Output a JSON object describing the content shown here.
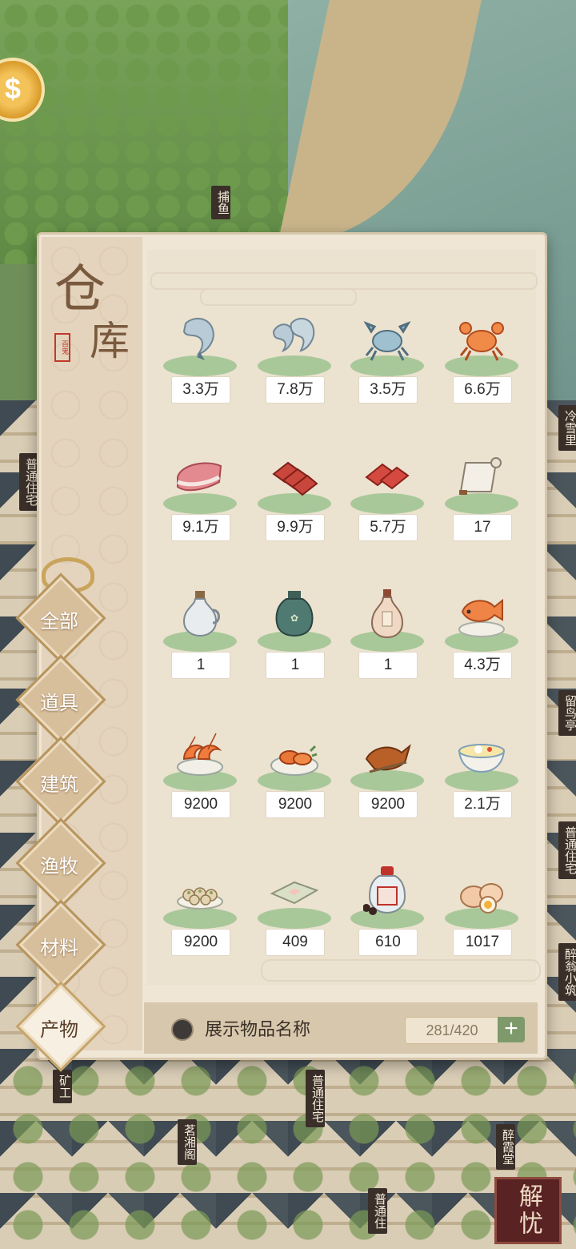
{
  "panel": {
    "title_char_1": "仓",
    "title_char_2": "库",
    "stamp": "百鬼"
  },
  "tabs": [
    {
      "label": "全部",
      "active": false
    },
    {
      "label": "道具",
      "active": false
    },
    {
      "label": "建筑",
      "active": false
    },
    {
      "label": "渔牧",
      "active": false
    },
    {
      "label": "材料",
      "active": false
    },
    {
      "label": "产物",
      "active": true
    }
  ],
  "items": [
    {
      "icon": "shrimp-icon",
      "qty": "3.3万"
    },
    {
      "icon": "shrimps-icon",
      "qty": "7.8万"
    },
    {
      "icon": "blue-crab-icon",
      "qty": "3.5万"
    },
    {
      "icon": "red-crab-icon",
      "qty": "6.6万"
    },
    {
      "icon": "pork-icon",
      "qty": "9.1万"
    },
    {
      "icon": "beef-slices-icon",
      "qty": "9.9万"
    },
    {
      "icon": "meat-slices-icon",
      "qty": "5.7万"
    },
    {
      "icon": "paper-scroll-icon",
      "qty": "17"
    },
    {
      "icon": "white-wine-jug-icon",
      "qty": "1"
    },
    {
      "icon": "green-wine-jar-icon",
      "qty": "1"
    },
    {
      "icon": "wine-bottle-icon",
      "qty": "1"
    },
    {
      "icon": "fish-dish-icon",
      "qty": "4.3万"
    },
    {
      "icon": "shrimp-dish-icon",
      "qty": "9200"
    },
    {
      "icon": "crab-dish-icon",
      "qty": "9200"
    },
    {
      "icon": "roast-duck-icon",
      "qty": "9200"
    },
    {
      "icon": "soup-bowl-icon",
      "qty": "2.1万"
    },
    {
      "icon": "dumplings-icon",
      "qty": "9200"
    },
    {
      "icon": "rice-cake-icon",
      "qty": "409"
    },
    {
      "icon": "sauce-bottle-icon",
      "qty": "610"
    },
    {
      "icon": "eggs-icon",
      "qty": "1017"
    }
  ],
  "footer": {
    "show_names_label": "展示物品名称",
    "capacity": "281/420",
    "add": "+"
  },
  "signs": {
    "fishing": "捕鱼",
    "lengxueli": "冷雪里",
    "house_left": "普通住宅",
    "liuniaoting": "留鸟亭",
    "house_right": "普通住宅",
    "zuiweng": "醉翁小筑",
    "mine": "矿工",
    "mingxiangge": "茗湘阁",
    "house_center": "普通住宅",
    "house_bottom": "普通住",
    "zuixia": "醉霞堂"
  },
  "seal": "解忧"
}
